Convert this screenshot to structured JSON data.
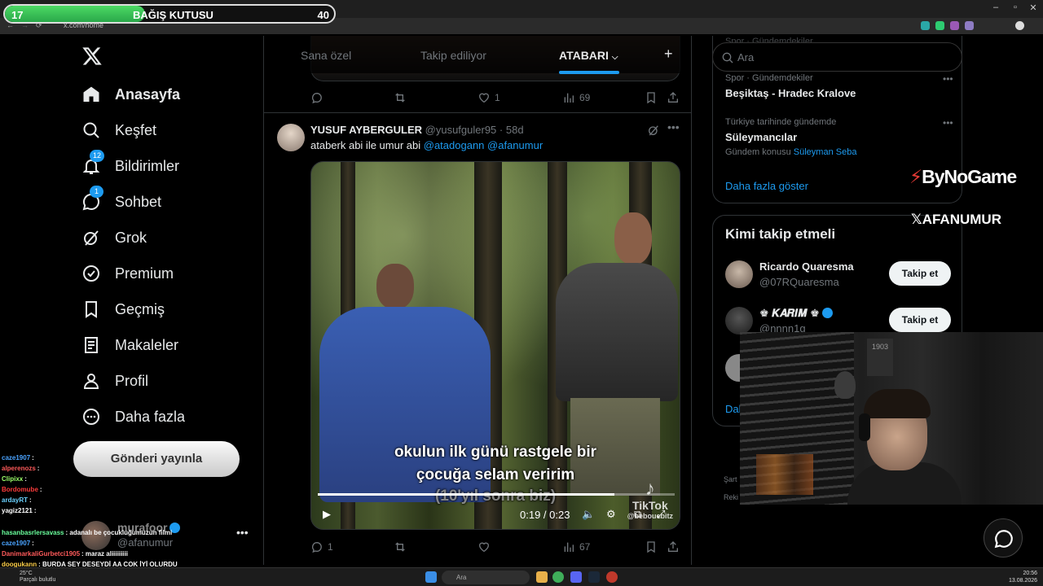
{
  "donation": {
    "current": "17",
    "title": "BAĞIŞ KUTUSU",
    "goal": "40",
    "progress_fraction": 0.425
  },
  "browser": {
    "url": "x.com/home"
  },
  "nav": {
    "items": [
      {
        "label": "Anasayfa",
        "icon": "home-icon",
        "bold": true
      },
      {
        "label": "Keşfet",
        "icon": "search-icon"
      },
      {
        "label": "Bildirimler",
        "icon": "bell-icon",
        "badge": "12"
      },
      {
        "label": "Sohbet",
        "icon": "chat-icon",
        "badge": "1"
      },
      {
        "label": "Grok",
        "icon": "grok-icon"
      },
      {
        "label": "Premium",
        "icon": "verified-icon"
      },
      {
        "label": "Geçmiş",
        "icon": "bookmark-icon"
      },
      {
        "label": "Makaleler",
        "icon": "article-icon"
      },
      {
        "label": "Profil",
        "icon": "person-icon"
      },
      {
        "label": "Daha fazla",
        "icon": "more-circle-icon"
      }
    ],
    "post_button": "Gönderi yayınla",
    "account": {
      "name": "murafoor",
      "handle": "@afanumur"
    }
  },
  "chat": [
    {
      "user": "caze1907",
      "text": ":",
      "color": "#4aa3ff"
    },
    {
      "user": "alperenozs",
      "text": ":",
      "color": "#ff5a5a"
    },
    {
      "user": "Clipixx",
      "text": ":",
      "color": "#9cff6a"
    },
    {
      "user": "Bordomube",
      "text": ":",
      "color": "#ff3b3b"
    },
    {
      "user": "ardayRT",
      "text": ":",
      "color": "#6ad1ff"
    },
    {
      "user": "yagiz2121",
      "text": ":",
      "color": "#ffffff"
    },
    {
      "user": "hasanbasrlersavass",
      "text": ": adanalı be çocukluğumuzun filmi",
      "color": "#6aff9c"
    },
    {
      "user": "caze1907",
      "text": ":",
      "color": "#4aa3ff"
    },
    {
      "user": "DanimarkaliGurbetci1905",
      "text": ": maraz aliiiiiiiii",
      "color": "#ff5a5a"
    },
    {
      "user": "doogukann",
      "text": ": BURDA SEY DESEYDİ AA COK İYİ OLURDU",
      "color": "#ffd04a"
    }
  ],
  "timeline": {
    "tabs": [
      {
        "label": "Sana özel"
      },
      {
        "label": "Takip ediliyor"
      },
      {
        "label": "ATABARI",
        "active": true
      }
    ],
    "prev_tweet": {
      "replies": "",
      "retweets": "",
      "likes": "1",
      "views": "69"
    },
    "tweet": {
      "author": "YUSUF AYBERGULER",
      "handle": "@yusufguler95",
      "time": "58d",
      "text_prefix": "ataberk abi ile umur abi ",
      "mention1": "@atadogann",
      "mention2": "@afanumur",
      "video": {
        "caption1": "okulun ilk günü rastgele bir",
        "caption2": "çocuğa selam veririm",
        "caption3": "(10'yıl sonra biz)",
        "watermark": "TikTok",
        "watermark_user": "@bebouebitz",
        "time": "0:19 / 0:23",
        "progress_fraction": 0.83
      },
      "stats": {
        "replies": "1",
        "retweets": "",
        "likes": "",
        "views": "67"
      }
    }
  },
  "sidebar": {
    "search_placeholder": "Ara",
    "trends": [
      {
        "category": "Spor · Gündemdekiler",
        "title": "Beşiktaş - Hradec Kralove"
      },
      {
        "category": "Türkiye tarihinde gündemde",
        "title": "Süleymancılar",
        "context_prefix": "Gündem konusu",
        "context_link": "Süleyman Seba"
      }
    ],
    "show_more": "Daha fazla göster",
    "who_to_follow": {
      "title": "Kimi takip etmeli",
      "users": [
        {
          "name": "Ricardo Quaresma",
          "handle": "@07RQuaresma",
          "button": "Takip et"
        },
        {
          "name": "♚ 𝑲𝑨𝑹𝑰𝑴 ♚",
          "handle": "@nnnn1g",
          "button": "Takip et"
        }
      ],
      "show_more_partial": "Dal"
    },
    "footer_partial": [
      "Şart",
      "Reki"
    ]
  },
  "branding": {
    "line1": "ByNoGame",
    "line2": "AFANUMUR"
  },
  "webcam": {
    "sign": "1903"
  },
  "taskbar": {
    "search": "Ara",
    "temp": "25°C",
    "weather": "Parçalı bulutlu",
    "time": "20:56",
    "date": "13.08.2026"
  }
}
